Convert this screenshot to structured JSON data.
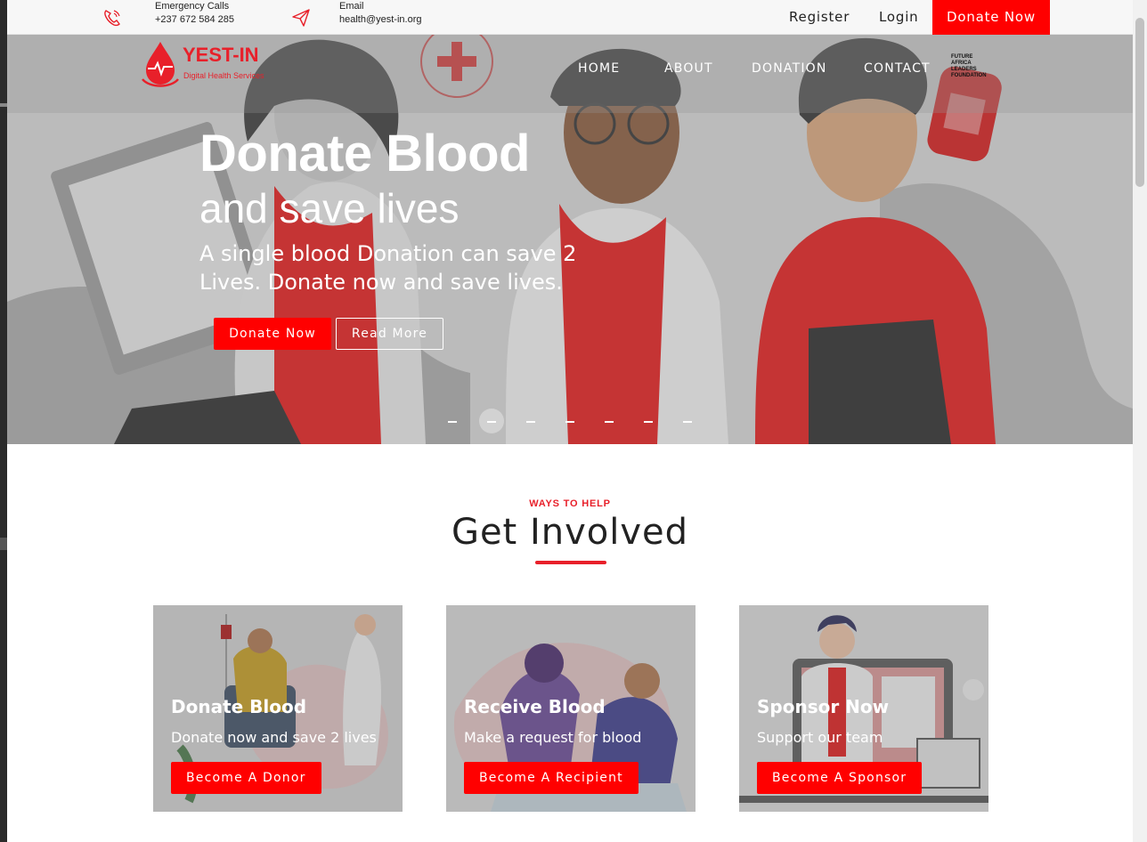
{
  "topbar": {
    "emergency_label": "Emergency Calls",
    "emergency_phone": "+237 672 584 285",
    "email_label": "Email",
    "email_value": "health@yest-in.org",
    "register": "Register",
    "login": "Login",
    "donate_now": "Donate Now"
  },
  "logo": {
    "name": "YEST-IN",
    "tagline": "Digital Health Services"
  },
  "nav": {
    "items": [
      "HOME",
      "ABOUT",
      "DONATION",
      "CONTACT"
    ]
  },
  "partner_logo": {
    "text": "FUTURE AFRICA LEADERS FOUNDATION"
  },
  "hero": {
    "title": "Donate Blood",
    "subtitle": "and save lives",
    "description": "A single blood Donation can save 2 Lives. Donate now and save lives.",
    "primary_button": "Donate Now",
    "secondary_button": "Read More",
    "slide_count": 7,
    "active_slide": 2
  },
  "section": {
    "eyebrow": "WAYS TO HELP",
    "title": "Get Involved"
  },
  "cards": [
    {
      "title": "Donate Blood",
      "description": "Donate now and save 2 lives",
      "button": "Become A Donor"
    },
    {
      "title": "Receive Blood",
      "description": "Make a request for blood",
      "button": "Become A Recipient"
    },
    {
      "title": "Sponsor Now",
      "description": "Support our team",
      "button": "Become A Sponsor"
    }
  ],
  "colors": {
    "accent": "#ff0000",
    "brand": "#e8202a"
  },
  "icons": {
    "phone": "phone-icon",
    "email": "paper-plane-icon"
  }
}
